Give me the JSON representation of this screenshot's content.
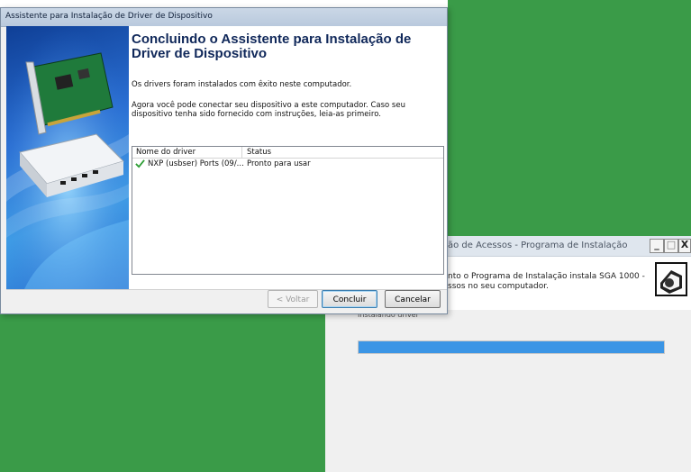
{
  "wizard": {
    "title": "Assistente para Instalação de Driver de Dispositivo",
    "heading": "Concluindo o Assistente para Instalação de Driver de Dispositivo",
    "message1": "Os drivers foram instalados com êxito neste computador.",
    "message2": "Agora você pode conectar seu dispositivo a este computador. Caso seu dispositivo tenha sido fornecido com instruções, leia-as primeiro.",
    "table": {
      "columns": [
        "Nome do driver",
        "Status"
      ],
      "rows": [
        {
          "name": "NXP (usbser) Ports  (09/...",
          "status": "Pronto para usar",
          "icon": "checkmark-icon"
        }
      ]
    },
    "buttons": {
      "back": "< Voltar",
      "finish": "Concluir",
      "cancel": "Cancelar"
    }
  },
  "installer": {
    "title": "ão de Acessos - Programa de Instalação",
    "description": "nto o Programa de Instalação instala SGA 1000 - ssos no seu computador.",
    "progress_label": "Instalando driver",
    "progress_fraction": 1.0,
    "controls": {
      "minimize": "_",
      "maximize": "□",
      "close": "X"
    }
  },
  "colors": {
    "desktop_green": "#3a9b48",
    "progress_blue": "#3b95e5",
    "heading_blue": "#10285a"
  }
}
